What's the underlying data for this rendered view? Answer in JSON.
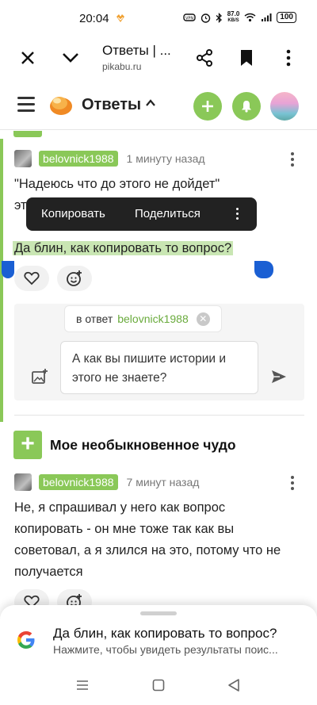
{
  "status": {
    "time": "20:04",
    "net_speed_value": "87.0",
    "net_speed_unit": "KB/S",
    "battery": "100"
  },
  "browser": {
    "title": "Ответы | ...",
    "url": "pikabu.ru"
  },
  "site": {
    "section_title": "Ответы",
    "brand_color": "#8ac858"
  },
  "comment1": {
    "username": "belovnick1988",
    "time": "1 минуту назад",
    "text_line1": "\"Надеюсь что до этого не дойдет\"",
    "text_line2_partial": "эт",
    "selected_text": "Да блин, как копировать то вопрос?"
  },
  "context_menu": {
    "copy": "Копировать",
    "share": "Поделиться"
  },
  "reply": {
    "prefix": "в ответ",
    "to_user": "belovnick1988",
    "input_value": "А как вы пишите истории и этого не знаете?"
  },
  "post": {
    "title": "Мое необыкновенное чудо"
  },
  "comment2": {
    "username": "belovnick1988",
    "time": "7 минут назад",
    "text": "Не, я спрашивал у него как вопрос копировать - он мне тоже так как вы советовал, а я злился на это, потому что не получается"
  },
  "google_sheet": {
    "query": "Да блин, как копировать то вопрос?",
    "hint": "Нажмите, чтобы увидеть результаты поис..."
  }
}
